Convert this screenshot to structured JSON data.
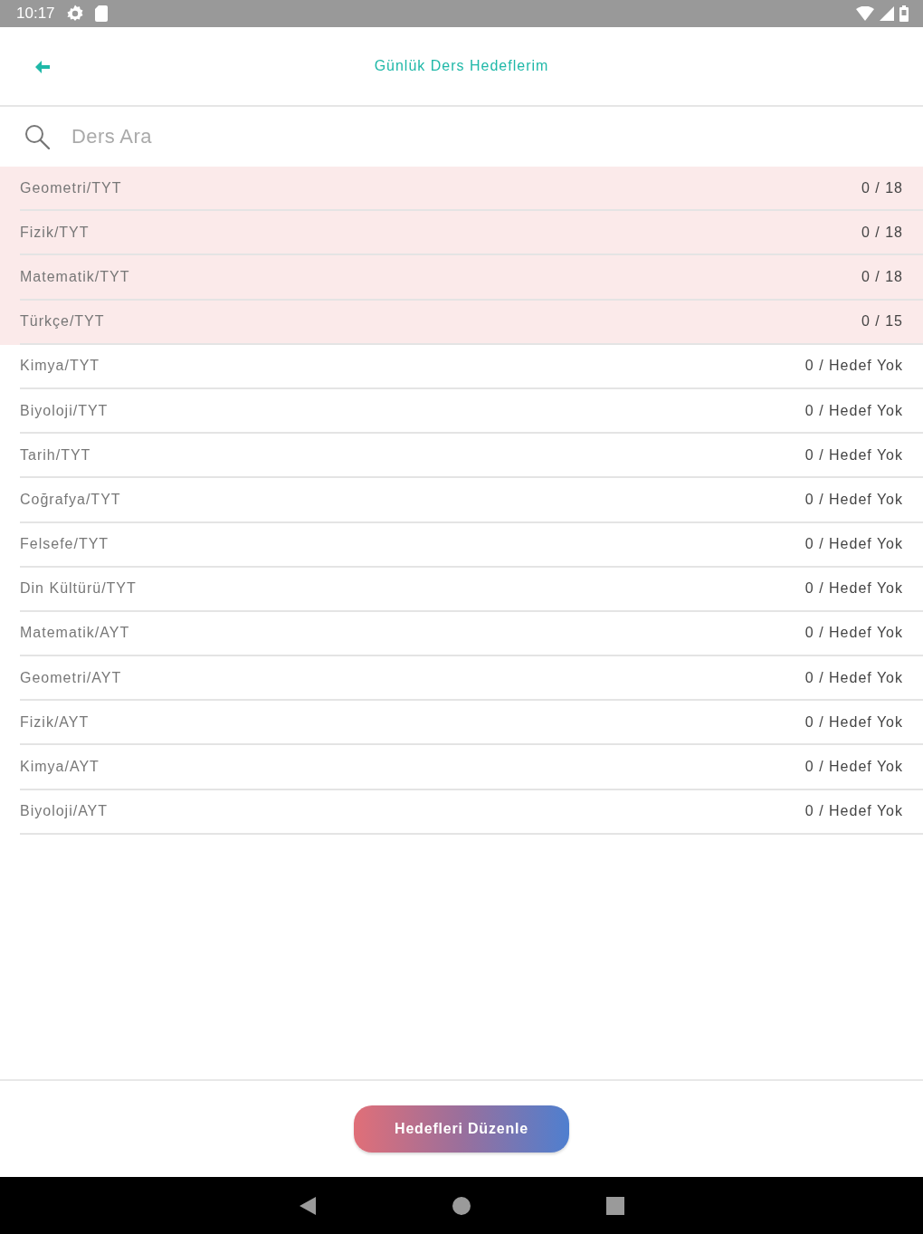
{
  "status_bar": {
    "time": "10:17"
  },
  "header": {
    "title": "Günlük Ders Hedeflerim"
  },
  "search": {
    "placeholder": "Ders Ara"
  },
  "rows": [
    {
      "subject": "Geometri/TYT",
      "progress": "0 / 18",
      "highlighted": true
    },
    {
      "subject": "Fizik/TYT",
      "progress": "0 / 18",
      "highlighted": true
    },
    {
      "subject": "Matematik/TYT",
      "progress": "0 / 18",
      "highlighted": true
    },
    {
      "subject": "Türkçe/TYT",
      "progress": "0 / 15",
      "highlighted": true
    },
    {
      "subject": "Kimya/TYT",
      "progress": "0 / Hedef Yok",
      "highlighted": false
    },
    {
      "subject": "Biyoloji/TYT",
      "progress": "0 / Hedef Yok",
      "highlighted": false
    },
    {
      "subject": "Tarih/TYT",
      "progress": "0 / Hedef Yok",
      "highlighted": false
    },
    {
      "subject": "Coğrafya/TYT",
      "progress": "0 / Hedef Yok",
      "highlighted": false
    },
    {
      "subject": "Felsefe/TYT",
      "progress": "0 / Hedef Yok",
      "highlighted": false
    },
    {
      "subject": "Din Kültürü/TYT",
      "progress": "0 / Hedef Yok",
      "highlighted": false
    },
    {
      "subject": "Matematik/AYT",
      "progress": "0 / Hedef Yok",
      "highlighted": false
    },
    {
      "subject": "Geometri/AYT",
      "progress": "0 / Hedef Yok",
      "highlighted": false
    },
    {
      "subject": "Fizik/AYT",
      "progress": "0 / Hedef Yok",
      "highlighted": false
    },
    {
      "subject": "Kimya/AYT",
      "progress": "0 / Hedef Yok",
      "highlighted": false
    },
    {
      "subject": "Biyoloji/AYT",
      "progress": "0 / Hedef Yok",
      "highlighted": false
    }
  ],
  "footer": {
    "button": "Hedefleri Düzenle"
  }
}
